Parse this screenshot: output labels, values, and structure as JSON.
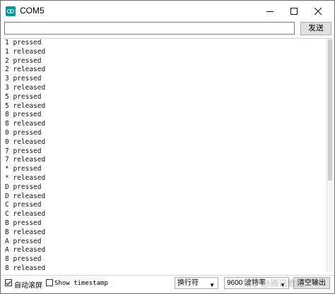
{
  "window": {
    "title": "COM5"
  },
  "input_row": {
    "input_value": "",
    "send_label": "发送"
  },
  "output_lines": [
    "1 pressed",
    "1 released",
    "2 pressed",
    "2 released",
    "3 pressed",
    "3 released",
    "5 pressed",
    "5 released",
    "8 pressed",
    "8 released",
    "0 pressed",
    "0 released",
    "7 pressed",
    "7 released",
    "* pressed",
    "* released",
    "D pressed",
    "D released",
    "C pressed",
    "C released",
    "B pressed",
    "B released",
    "A pressed",
    "A released",
    "8 pressed",
    "8 released"
  ],
  "bottom": {
    "autoscroll_label": "自动滚屏",
    "autoscroll_checked": true,
    "timestamp_label": "Show timestamp",
    "timestamp_checked": false,
    "line_ending": "换行符",
    "baud": "9600 波特率",
    "clear_label": "清空输出"
  },
  "watermark": "知乎 @腾讯教程"
}
